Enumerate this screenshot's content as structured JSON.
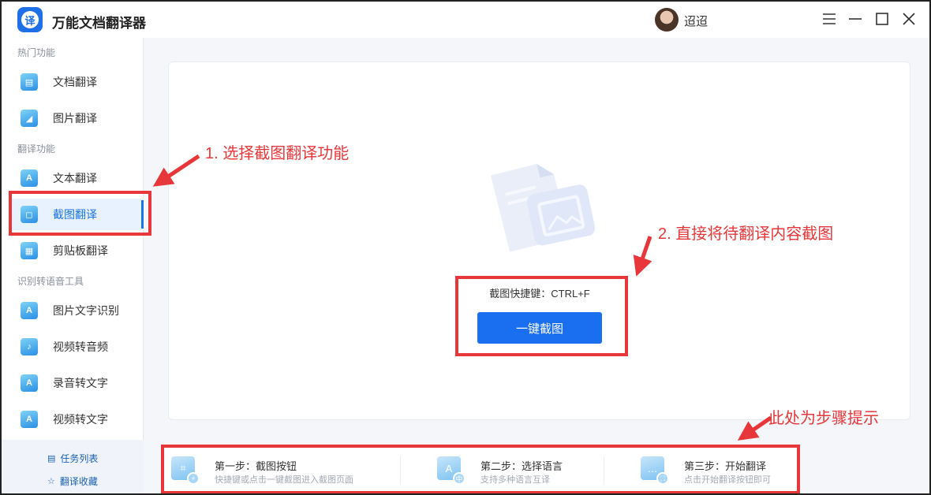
{
  "app": {
    "logo_char": "译",
    "title": "万能文档翻译器",
    "user_name": "迢迢"
  },
  "window_controls": {
    "menu": "☰",
    "minimize": "—",
    "maximize": "☐",
    "close": "✕"
  },
  "sidebar": {
    "sections": [
      {
        "label": "热门功能",
        "items": [
          {
            "label": "文档翻译",
            "icon": "document-icon"
          },
          {
            "label": "图片翻译",
            "icon": "image-icon"
          }
        ]
      },
      {
        "label": "翻译功能",
        "items": [
          {
            "label": "文本翻译",
            "icon": "text-icon"
          },
          {
            "label": "截图翻译",
            "icon": "screenshot-icon",
            "active": true
          },
          {
            "label": "剪贴板翻译",
            "icon": "clipboard-icon"
          }
        ]
      },
      {
        "label": "识别转语音工具",
        "items": [
          {
            "label": "图片文字识别",
            "icon": "ocr-icon"
          },
          {
            "label": "视频转音频",
            "icon": "video-icon"
          },
          {
            "label": "录音转文字",
            "icon": "recording-icon"
          },
          {
            "label": "视频转文字",
            "icon": "video-text-icon"
          }
        ]
      }
    ],
    "bottom": {
      "task_list": "任务列表",
      "favorites": "翻译收藏"
    }
  },
  "main": {
    "shortcut_text": "截图快捷键：CTRL+F",
    "capture_button": "一键截图"
  },
  "steps": [
    {
      "title": "第一步：截图按钮",
      "desc": "快捷键或点击一键截图进入截图页面",
      "icon": "crop-icon"
    },
    {
      "title": "第二步：选择语言",
      "desc": "支持多种语言互译",
      "icon": "language-icon"
    },
    {
      "title": "第三步：开始翻译",
      "desc": "点击开始翻译按钮即可",
      "icon": "translate-icon"
    }
  ],
  "annotations": {
    "step1": "1. 选择截图翻译功能",
    "step2": "2. 直接将待翻译内容截图",
    "steps_hint": "此处为步骤提示"
  },
  "colors": {
    "accent": "#1a6ff0",
    "annotation": "#e8373a"
  }
}
